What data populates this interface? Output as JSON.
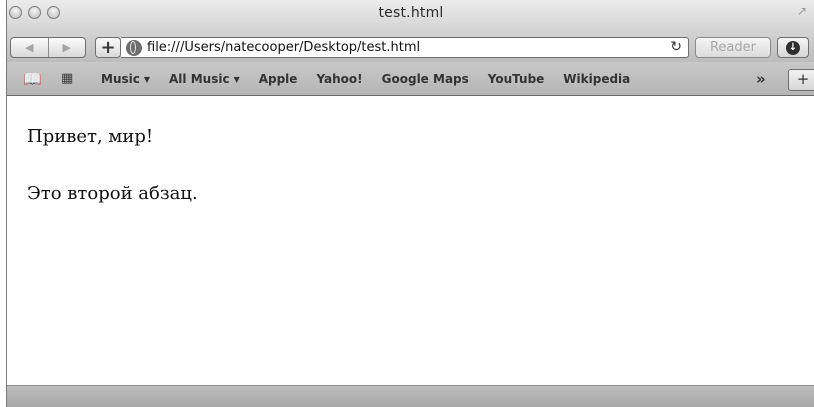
{
  "window": {
    "title": "test.html"
  },
  "toolbar": {
    "back_icon": "back-arrow-icon",
    "forward_icon": "forward-arrow-icon",
    "add_label": "+",
    "url": "file:///Users/natecooper/Desktop/test.html",
    "reload_glyph": "↻",
    "reader_label": "Reader"
  },
  "bookmarks": {
    "items": [
      {
        "label": "Music",
        "has_menu": true
      },
      {
        "label": "All Music",
        "has_menu": true
      },
      {
        "label": "Apple",
        "has_menu": false
      },
      {
        "label": "Yahoo!",
        "has_menu": false
      },
      {
        "label": "Google Maps",
        "has_menu": false
      },
      {
        "label": "YouTube",
        "has_menu": false
      },
      {
        "label": "Wikipedia",
        "has_menu": false
      }
    ],
    "overflow_glyph": "»",
    "new_tab_label": "+"
  },
  "content": {
    "paragraphs": [
      "Привет, мир!",
      "Это второй абзац."
    ]
  },
  "colors": {
    "chrome_light": "#ececec",
    "chrome_dark": "#b5b5b5",
    "text": "#111111"
  }
}
